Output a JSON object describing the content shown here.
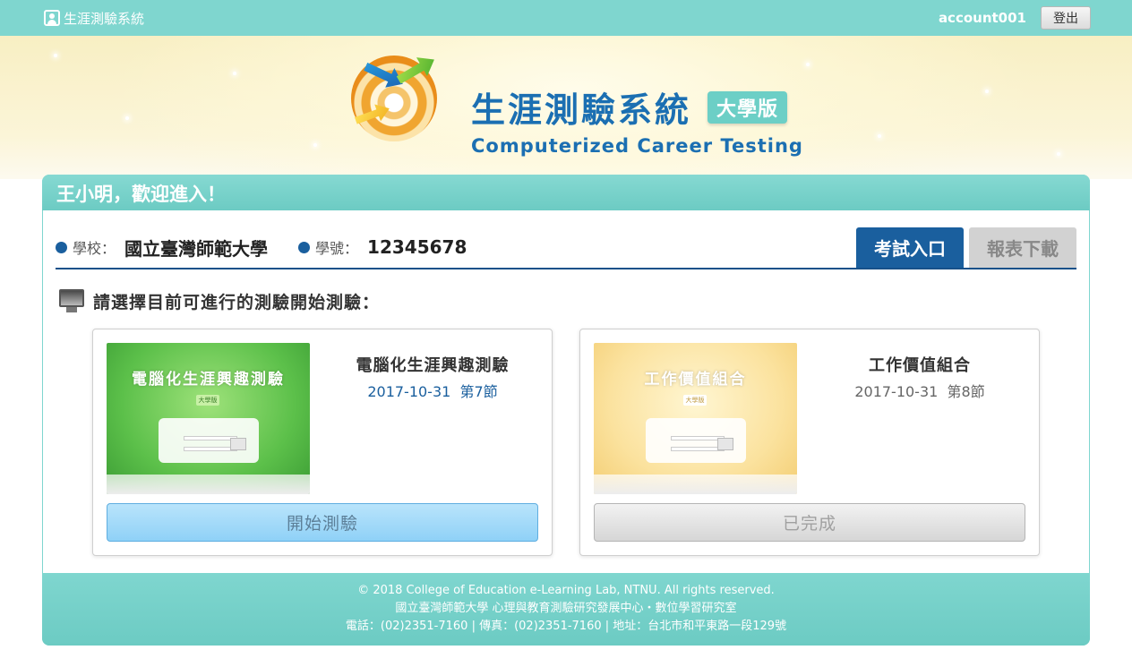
{
  "topbar": {
    "brand": "生涯測驗系統",
    "account": "account001",
    "logout_label": "登出"
  },
  "hero": {
    "title": "生涯測驗系統",
    "badge": "大學版",
    "subtitle": "Computerized Career Testing"
  },
  "panel": {
    "welcome": "王小明，歡迎進入！",
    "school_label": "學校：",
    "school_value": "國立臺灣師範大學",
    "id_label": "學號：",
    "id_value": "12345678",
    "tabs": [
      {
        "label": "考試入口",
        "active": true
      },
      {
        "label": "報表下載",
        "active": false
      }
    ],
    "prompt": "請選擇目前可進行的測驗開始測驗：",
    "cards": [
      {
        "title": "電腦化生涯興趣測驗",
        "date": "2017-10-31",
        "period": "第7節",
        "thumb_title": "電腦化生涯興趣測驗",
        "thumb_badge": "大學版",
        "button": "開始測驗",
        "status": "start"
      },
      {
        "title": "工作價值組合",
        "date": "2017-10-31",
        "period": "第8節",
        "thumb_title": "工作價值組合",
        "thumb_badge": "大學版",
        "button": "已完成",
        "status": "done"
      }
    ]
  },
  "footer": {
    "line1": "© 2018 College of Education e-Learning Lab, NTNU. All rights reserved.",
    "line2": "國立臺灣師範大學 心理與教育測驗研究發展中心・數位學習研究室",
    "line3": "電話：(02)2351-7160 | 傳真：(02)2351-7160 | 地址：台北市和平東路一段129號"
  },
  "colors": {
    "teal": "#7fd6cf",
    "navy": "#1a5f9e",
    "start_button": "#8fd1f7"
  }
}
